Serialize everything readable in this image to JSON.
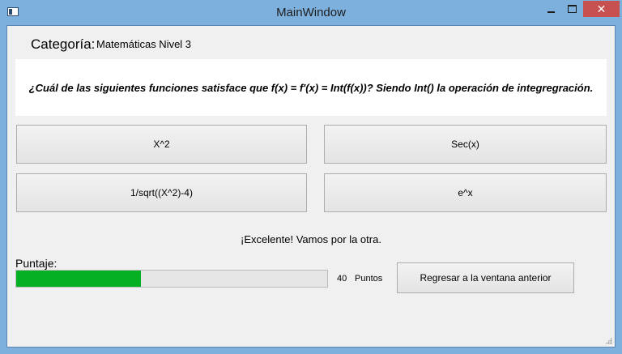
{
  "window": {
    "title": "MainWindow",
    "close_label": "✕"
  },
  "category": {
    "label": "Categoría:",
    "value": "Matemáticas Nivel 3"
  },
  "question": "¿Cuál de las siguientes funciones satisface que f(x) = f'(x) = Int(f(x))? Siendo Int() la operación de integregración.",
  "options": [
    {
      "label": "X^2"
    },
    {
      "label": "Sec(x)"
    },
    {
      "label": "1/sqrt((X^2)-4)"
    },
    {
      "label": "e^x"
    }
  ],
  "feedback": "¡Excelente! Vamos por la otra.",
  "score": {
    "label": "Puntaje:",
    "progress_fraction": 0.4,
    "value": "40",
    "unit": "Puntos",
    "bar_color": "#06b025"
  },
  "back_button": {
    "label": "Regresar a la ventana anterior"
  },
  "colors": {
    "titlebar": "#7eb0de",
    "close_button": "#c75050",
    "client_background": "#f0f0f0"
  }
}
